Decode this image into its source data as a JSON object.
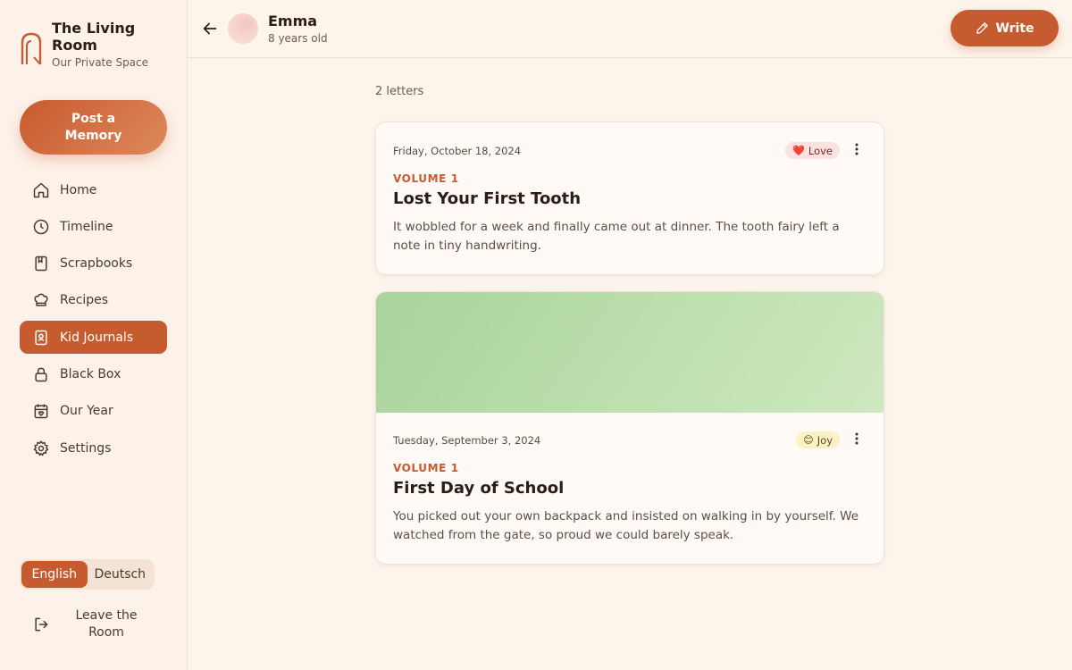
{
  "app": {
    "title": "The Living Room",
    "subtitle": "Our Private Space"
  },
  "sidebar": {
    "post_button": "Post a Memory",
    "items": [
      {
        "label": "Home",
        "icon": "home-icon"
      },
      {
        "label": "Timeline",
        "icon": "clock-icon"
      },
      {
        "label": "Scrapbooks",
        "icon": "book-icon"
      },
      {
        "label": "Recipes",
        "icon": "chef-hat-icon"
      },
      {
        "label": "Kid Journals",
        "icon": "journal-icon",
        "active": true
      },
      {
        "label": "Black Box",
        "icon": "lock-icon"
      },
      {
        "label": "Our Year",
        "icon": "calendar-heart-icon"
      },
      {
        "label": "Settings",
        "icon": "gear-icon"
      }
    ],
    "languages": [
      "English",
      "Deutsch"
    ],
    "active_language": "English",
    "leave": "Leave the Room"
  },
  "header": {
    "child_name": "Emma",
    "child_age": "8 years old",
    "write_button": "Write"
  },
  "main": {
    "count": "2 letters",
    "letters": [
      {
        "date": "Friday, October 18, 2024",
        "mood": "Love",
        "mood_emoji": "❤️",
        "volume": "VOLUME 1",
        "title": "Lost Your First Tooth",
        "excerpt": "It wobbled for a week and finally came out at dinner. The tooth fairy left a note in tiny handwriting."
      },
      {
        "date": "Tuesday, September 3, 2024",
        "mood": "Joy",
        "mood_emoji": "😊",
        "volume": "VOLUME 1",
        "title": "First Day of School",
        "excerpt": "You picked out your own backpack and insisted on walking in by yourself. We watched from the gate, so proud we could barely speak."
      }
    ]
  },
  "colors": {
    "accent": "#c75b30",
    "background": "#fdf4ec",
    "card": "#fffaf6"
  }
}
